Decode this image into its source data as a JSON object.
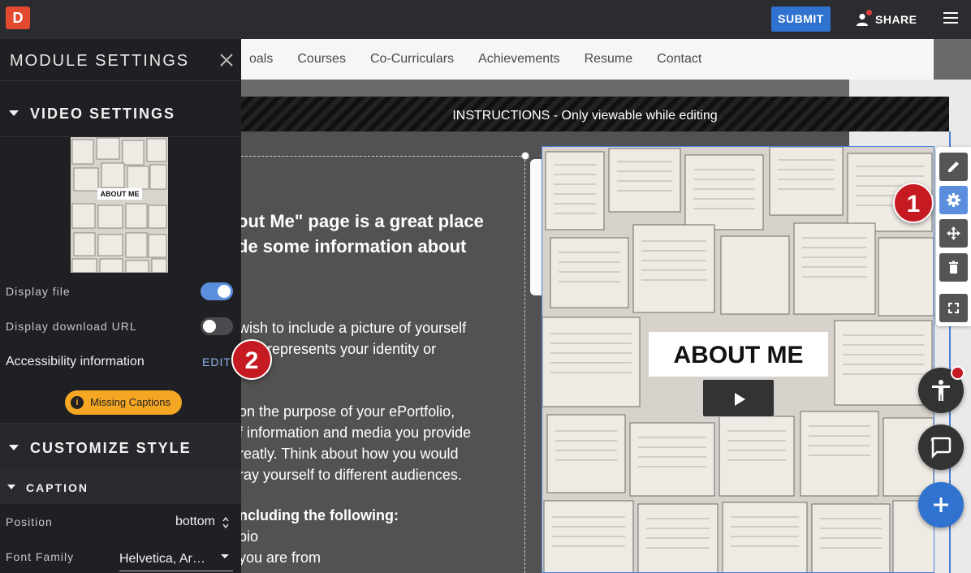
{
  "topbar": {
    "logo": "D",
    "submit_label": "SUBMIT",
    "share_label": "SHARE"
  },
  "site_nav": [
    "oals",
    "Courses",
    "Co-Curriculars",
    "Achievements",
    "Resume",
    "Contact"
  ],
  "instructions": "INSTRUCTIONS - Only viewable while editing",
  "content": {
    "heading_lines": [
      "out Me\" page is a great place",
      "de some information about",
      "."
    ],
    "para1": [
      "wish to include a picture of yourself",
      "that represents your identity or",
      "d.\""
    ],
    "para2": [
      "on the purpose of your ePortfolio,",
      "f information and media you provide",
      "reatly. Think about how you would",
      "ray yourself to different audiences."
    ],
    "para3_bold": "ncluding the following:",
    "para3": [
      "bio",
      "you are from"
    ]
  },
  "video": {
    "title": "ABOUT ME"
  },
  "callouts": {
    "one": "1",
    "two": "2"
  },
  "module_settings": {
    "title": "MODULE SETTINGS",
    "video_settings_title": "VIDEO SETTINGS",
    "thumb_title": "ABOUT ME",
    "display_file_label": "Display file",
    "display_file_on": true,
    "display_download_url_label": "Display download URL",
    "display_download_url_on": false,
    "accessibility_label": "Accessibility information",
    "edit_label": "EDIT",
    "missing_captions_label": "Missing Captions",
    "customize_style_title": "CUSTOMIZE STYLE",
    "caption_title": "CAPTION",
    "position_label": "Position",
    "position_value": "bottom",
    "font_family_label": "Font Family",
    "font_family_value": "Helvetica, Ar…"
  },
  "colors": {
    "accent_blue": "#2f72cf",
    "brand_red": "#e2492f",
    "badge_red": "#c61a22",
    "warning_orange": "#f5a623",
    "toggle_on": "#5b8fde"
  }
}
